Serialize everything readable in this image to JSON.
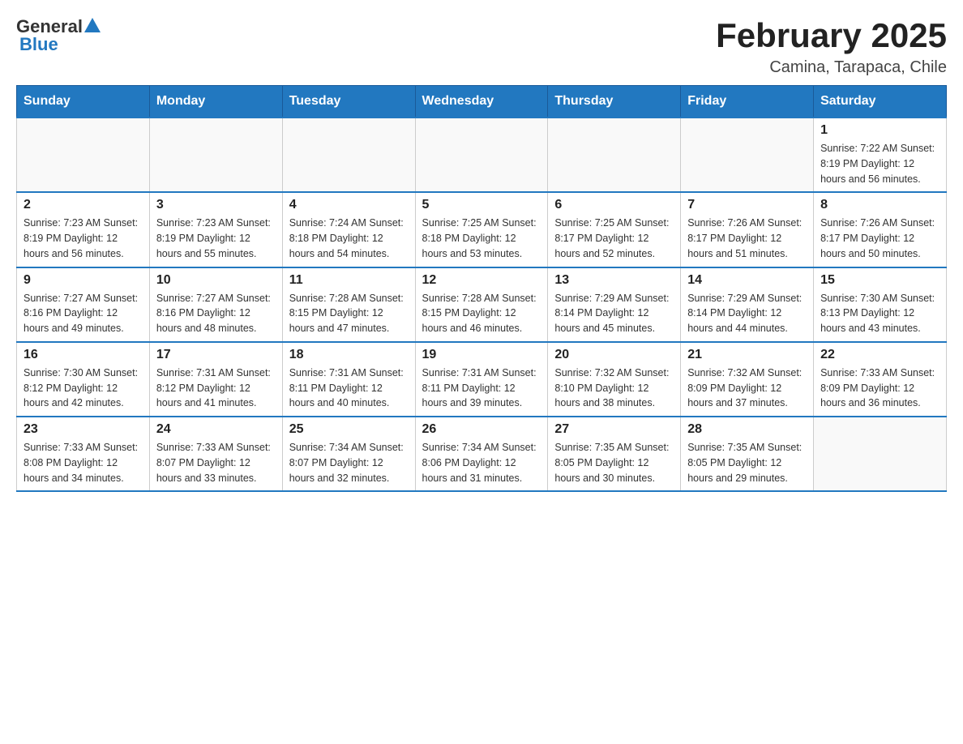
{
  "header": {
    "logo": {
      "general": "General",
      "blue": "Blue"
    },
    "title": "February 2025",
    "subtitle": "Camina, Tarapaca, Chile"
  },
  "weekdays": [
    "Sunday",
    "Monday",
    "Tuesday",
    "Wednesday",
    "Thursday",
    "Friday",
    "Saturday"
  ],
  "weeks": [
    [
      {
        "day": "",
        "info": ""
      },
      {
        "day": "",
        "info": ""
      },
      {
        "day": "",
        "info": ""
      },
      {
        "day": "",
        "info": ""
      },
      {
        "day": "",
        "info": ""
      },
      {
        "day": "",
        "info": ""
      },
      {
        "day": "1",
        "info": "Sunrise: 7:22 AM\nSunset: 8:19 PM\nDaylight: 12 hours and 56 minutes."
      }
    ],
    [
      {
        "day": "2",
        "info": "Sunrise: 7:23 AM\nSunset: 8:19 PM\nDaylight: 12 hours and 56 minutes."
      },
      {
        "day": "3",
        "info": "Sunrise: 7:23 AM\nSunset: 8:19 PM\nDaylight: 12 hours and 55 minutes."
      },
      {
        "day": "4",
        "info": "Sunrise: 7:24 AM\nSunset: 8:18 PM\nDaylight: 12 hours and 54 minutes."
      },
      {
        "day": "5",
        "info": "Sunrise: 7:25 AM\nSunset: 8:18 PM\nDaylight: 12 hours and 53 minutes."
      },
      {
        "day": "6",
        "info": "Sunrise: 7:25 AM\nSunset: 8:17 PM\nDaylight: 12 hours and 52 minutes."
      },
      {
        "day": "7",
        "info": "Sunrise: 7:26 AM\nSunset: 8:17 PM\nDaylight: 12 hours and 51 minutes."
      },
      {
        "day": "8",
        "info": "Sunrise: 7:26 AM\nSunset: 8:17 PM\nDaylight: 12 hours and 50 minutes."
      }
    ],
    [
      {
        "day": "9",
        "info": "Sunrise: 7:27 AM\nSunset: 8:16 PM\nDaylight: 12 hours and 49 minutes."
      },
      {
        "day": "10",
        "info": "Sunrise: 7:27 AM\nSunset: 8:16 PM\nDaylight: 12 hours and 48 minutes."
      },
      {
        "day": "11",
        "info": "Sunrise: 7:28 AM\nSunset: 8:15 PM\nDaylight: 12 hours and 47 minutes."
      },
      {
        "day": "12",
        "info": "Sunrise: 7:28 AM\nSunset: 8:15 PM\nDaylight: 12 hours and 46 minutes."
      },
      {
        "day": "13",
        "info": "Sunrise: 7:29 AM\nSunset: 8:14 PM\nDaylight: 12 hours and 45 minutes."
      },
      {
        "day": "14",
        "info": "Sunrise: 7:29 AM\nSunset: 8:14 PM\nDaylight: 12 hours and 44 minutes."
      },
      {
        "day": "15",
        "info": "Sunrise: 7:30 AM\nSunset: 8:13 PM\nDaylight: 12 hours and 43 minutes."
      }
    ],
    [
      {
        "day": "16",
        "info": "Sunrise: 7:30 AM\nSunset: 8:12 PM\nDaylight: 12 hours and 42 minutes."
      },
      {
        "day": "17",
        "info": "Sunrise: 7:31 AM\nSunset: 8:12 PM\nDaylight: 12 hours and 41 minutes."
      },
      {
        "day": "18",
        "info": "Sunrise: 7:31 AM\nSunset: 8:11 PM\nDaylight: 12 hours and 40 minutes."
      },
      {
        "day": "19",
        "info": "Sunrise: 7:31 AM\nSunset: 8:11 PM\nDaylight: 12 hours and 39 minutes."
      },
      {
        "day": "20",
        "info": "Sunrise: 7:32 AM\nSunset: 8:10 PM\nDaylight: 12 hours and 38 minutes."
      },
      {
        "day": "21",
        "info": "Sunrise: 7:32 AM\nSunset: 8:09 PM\nDaylight: 12 hours and 37 minutes."
      },
      {
        "day": "22",
        "info": "Sunrise: 7:33 AM\nSunset: 8:09 PM\nDaylight: 12 hours and 36 minutes."
      }
    ],
    [
      {
        "day": "23",
        "info": "Sunrise: 7:33 AM\nSunset: 8:08 PM\nDaylight: 12 hours and 34 minutes."
      },
      {
        "day": "24",
        "info": "Sunrise: 7:33 AM\nSunset: 8:07 PM\nDaylight: 12 hours and 33 minutes."
      },
      {
        "day": "25",
        "info": "Sunrise: 7:34 AM\nSunset: 8:07 PM\nDaylight: 12 hours and 32 minutes."
      },
      {
        "day": "26",
        "info": "Sunrise: 7:34 AM\nSunset: 8:06 PM\nDaylight: 12 hours and 31 minutes."
      },
      {
        "day": "27",
        "info": "Sunrise: 7:35 AM\nSunset: 8:05 PM\nDaylight: 12 hours and 30 minutes."
      },
      {
        "day": "28",
        "info": "Sunrise: 7:35 AM\nSunset: 8:05 PM\nDaylight: 12 hours and 29 minutes."
      },
      {
        "day": "",
        "info": ""
      }
    ]
  ]
}
